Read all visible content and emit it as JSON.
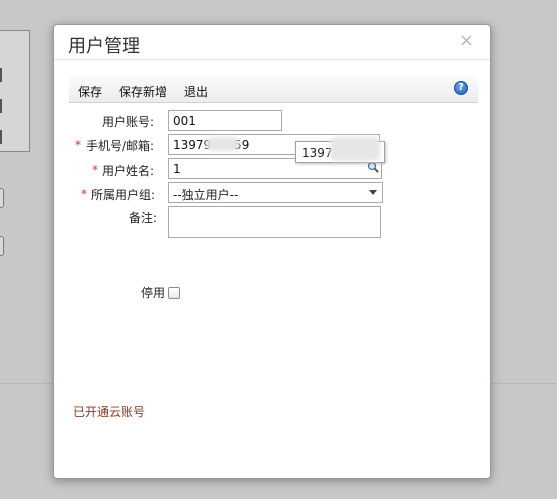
{
  "dialog": {
    "title": "用户管理",
    "close_glyph": "×"
  },
  "toolbar": {
    "save": "保存",
    "save_new": "保存新增",
    "exit": "退出",
    "help_glyph": "?"
  },
  "form": {
    "account_label": "用户账号:",
    "account_value": "001",
    "phone_label": "手机号/邮箱:",
    "phone_value": "13979      59",
    "phone_suggestion": "1397",
    "name_label": "用户姓名:",
    "name_value": "1",
    "group_label": "所属用户组:",
    "group_value": "--独立用户--",
    "remark_label": "备注:",
    "disable_label": "停用",
    "required_mark": "*"
  },
  "status": {
    "cloud_account": "已开通云账号"
  }
}
